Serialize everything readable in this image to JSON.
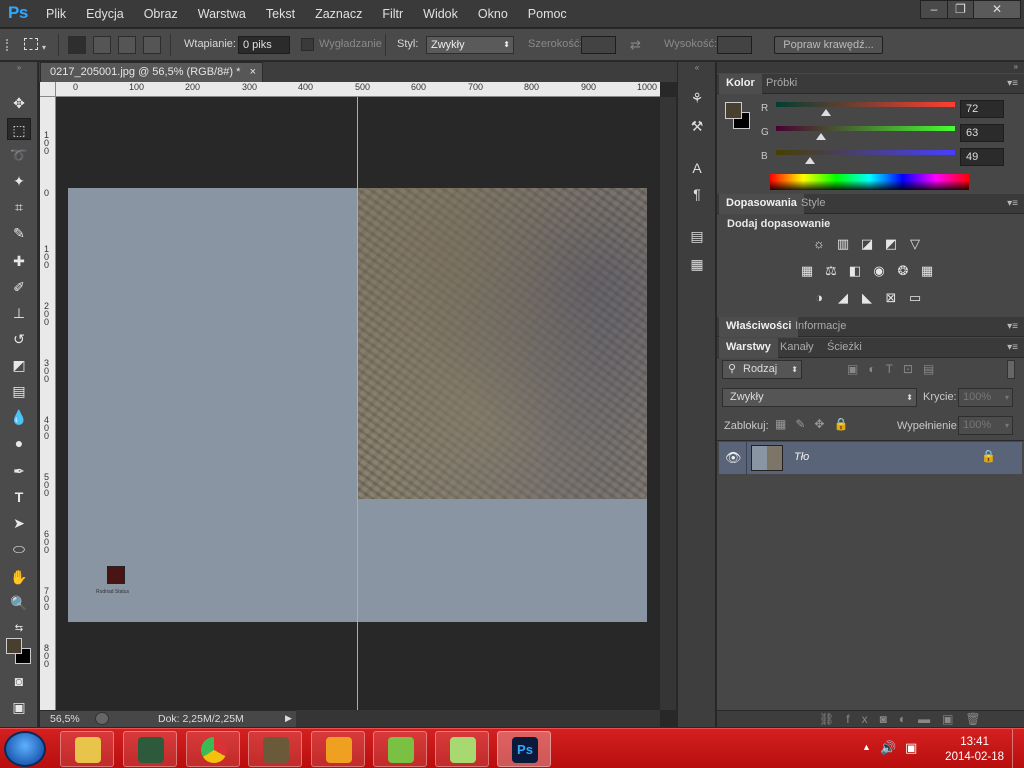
{
  "app": {
    "logo": "Ps",
    "menus": [
      "Plik",
      "Edycja",
      "Obraz",
      "Warstwa",
      "Tekst",
      "Zaznacz",
      "Filtr",
      "Widok",
      "Okno",
      "Pomoc"
    ],
    "window_buttons": [
      "–",
      "❐",
      "✕"
    ]
  },
  "options_bar": {
    "feather_label": "Wtapianie:",
    "feather_value": "0 piks",
    "antialias_label": "Wygładzanie",
    "style_label": "Styl:",
    "style_value": "Zwykły",
    "width_label": "Szerokość:",
    "height_label": "Wysokość:",
    "refine_edge_button": "Popraw krawędź..."
  },
  "document": {
    "tab_title": "0217_205001.jpg @ 56,5% (RGB/8#) *",
    "close_glyph": "×",
    "zoom": "56,5%",
    "doc_size": "Dok: 2,25M/2,25M",
    "logo_caption": "Rodriad Status"
  },
  "ruler": {
    "h_ticks": [
      "0",
      "100",
      "200",
      "300",
      "400",
      "500",
      "600",
      "700",
      "800",
      "900",
      "1000"
    ],
    "v_ticks": [
      "1 0 0",
      "0",
      "1 0 0",
      "2 0 0",
      "3 0 0",
      "4 0 0",
      "5 0 0",
      "6 0 0",
      "7 0 0",
      "8 0 0"
    ]
  },
  "color_panel": {
    "tabs": [
      "Kolor",
      "Próbki"
    ],
    "channels": [
      {
        "label": "R",
        "value": "72",
        "fraction": 0.28
      },
      {
        "label": "G",
        "value": "63",
        "fraction": 0.25
      },
      {
        "label": "B",
        "value": "49",
        "fraction": 0.19
      }
    ],
    "foreground_color": "#483f31",
    "background_color": "#000000"
  },
  "adjustments_panel": {
    "tabs": [
      "Dopasowania",
      "Style"
    ],
    "heading": "Dodaj dopasowanie",
    "icons_row1": [
      "brightness-icon",
      "levels-icon",
      "curves-icon",
      "exposure-icon",
      "vibrance-icon"
    ],
    "icons_row2": [
      "hue-saturation-icon",
      "color-balance-icon",
      "black-white-icon",
      "photo-filter-icon",
      "channel-mixer-icon",
      "color-lookup-icon"
    ],
    "icons_row3": [
      "invert-icon",
      "posterize-icon",
      "threshold-icon",
      "selective-color-icon",
      "gradient-map-icon"
    ]
  },
  "properties_tabs": [
    "Właściwości",
    "Informacje"
  ],
  "layers_panel": {
    "tabs": [
      "Warstwy",
      "Kanały",
      "Ścieżki"
    ],
    "filter_label": "Rodzaj",
    "blend_mode": "Zwykły",
    "opacity_label": "Krycie:",
    "opacity_value": "100%",
    "lock_label": "Zablokuj:",
    "fill_label": "Wypełnienie:",
    "fill_value": "100%",
    "layers": [
      {
        "name": "Tło",
        "visible": true,
        "locked": true
      }
    ]
  },
  "taskbar": {
    "time": "13:41",
    "date": "2014-02-18"
  }
}
